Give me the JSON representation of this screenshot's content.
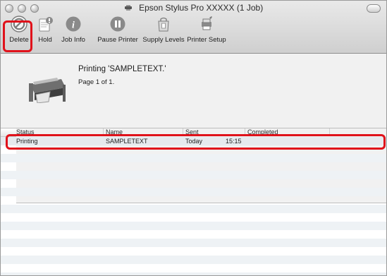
{
  "window": {
    "title": "Epson Stylus Pro XXXXX (1 Job)"
  },
  "toolbar": {
    "delete_label": "Delete",
    "hold_label": "Hold",
    "job_info_label": "Job Info",
    "pause_printer_label": "Pause Printer",
    "supply_levels_label": "Supply Levels",
    "printer_setup_label": "Printer Setup"
  },
  "status": {
    "line1": "Printing 'SAMPLETEXT.'",
    "line2": "Page 1 of 1."
  },
  "table": {
    "headers": {
      "status": "Status",
      "name": "Name",
      "sent": "Sent",
      "completed": "Completed"
    },
    "rows": [
      {
        "status": "Printing",
        "name": "SAMPLETEXT",
        "sent_day": "Today",
        "sent_time": "15:15",
        "completed": ""
      }
    ]
  },
  "colors": {
    "highlight_red": "#e0121b",
    "row_stripe": "#eef2f5"
  },
  "icons": {
    "title": "printer-icon",
    "delete": "delete-icon",
    "hold": "hold-icon",
    "job_info": "info-icon",
    "pause_printer": "pause-icon",
    "supply_levels": "supply-levels-icon",
    "printer_setup": "printer-setup-icon",
    "status_printer": "printer-image"
  }
}
